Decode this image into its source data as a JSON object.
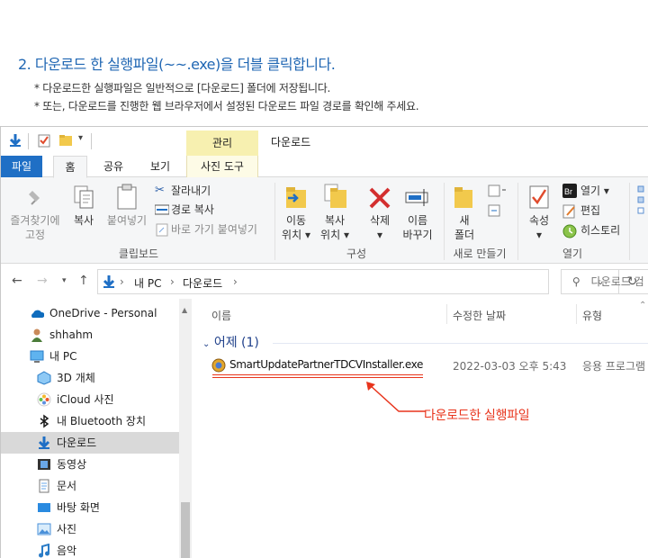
{
  "instruction": {
    "title": "2. 다운로드 한 실행파일(~~.exe)을 더블 클릭합니다.",
    "note1": "* 다운로드한 실행파일은 일반적으로 [다운로드] 폴더에 저장됩니다.",
    "note2": "* 또는, 다운로드를 진행한 웹 브라우저에서 설정된 다운로드 파일 경로를 확인해 주세요."
  },
  "window": {
    "title": "다운로드",
    "context_tab": "관리"
  },
  "tabs": {
    "file": "파일",
    "home": "홈",
    "share": "공유",
    "view": "보기",
    "picture_tools": "사진 도구"
  },
  "ribbon": {
    "clipboard": {
      "pin_quick_line1": "즐겨찾기에",
      "pin_quick_line2": "고정",
      "copy": "복사",
      "paste": "붙여넣기",
      "cut": "잘라내기",
      "copy_path": "경로 복사",
      "paste_shortcut": "바로 가기 붙여넣기",
      "group_label": "클립보드"
    },
    "organize": {
      "move_line1": "이동",
      "move_line2": "위치",
      "copy_line1": "복사",
      "copy_line2": "위치",
      "delete": "삭제",
      "rename_line1": "이름",
      "rename_line2": "바꾸기",
      "group_label": "구성"
    },
    "new": {
      "new_folder_line1": "새",
      "new_folder_line2": "폴더",
      "group_label": "새로 만들기"
    },
    "open": {
      "properties": "속성",
      "open": "열기",
      "edit": "편집",
      "history": "히스토리",
      "group_label": "열기"
    }
  },
  "address": {
    "pc": "내 PC",
    "folder": "다운로드",
    "search_placeholder": "다운로드 검"
  },
  "nav": [
    {
      "label": "OneDrive - Personal",
      "icon": "onedrive-icon"
    },
    {
      "label": "shhahm",
      "icon": "user-icon"
    },
    {
      "label": "내 PC",
      "icon": "pc-icon"
    },
    {
      "label": "3D 개체",
      "icon": "3d-objects-icon"
    },
    {
      "label": "iCloud 사진",
      "icon": "icloud-photos-icon"
    },
    {
      "label": "내 Bluetooth 장치",
      "icon": "bluetooth-icon"
    },
    {
      "label": "다운로드",
      "icon": "download-icon",
      "selected": true
    },
    {
      "label": "동영상",
      "icon": "video-icon"
    },
    {
      "label": "문서",
      "icon": "document-icon"
    },
    {
      "label": "바탕 화면",
      "icon": "desktop-icon"
    },
    {
      "label": "사진",
      "icon": "pictures-icon"
    },
    {
      "label": "음악",
      "icon": "music-icon"
    }
  ],
  "columns": {
    "name": "이름",
    "modified": "수정한 날짜",
    "type": "유형"
  },
  "group": {
    "label": "어제 (1)"
  },
  "file": {
    "name": "SmartUpdatePartnerTDCVInstaller.exe",
    "modified": "2022-03-03 오후 5:43",
    "type": "응용 프로그램"
  },
  "annotation": {
    "callout": "다운로드한 실행파일",
    "color": "#e8341c"
  }
}
